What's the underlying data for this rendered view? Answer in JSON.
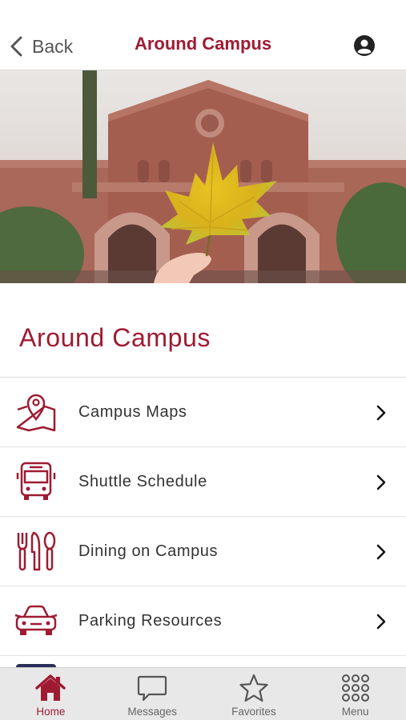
{
  "header": {
    "back_label": "Back",
    "title": "Around Campus"
  },
  "section": {
    "title": "Around Campus"
  },
  "list": [
    {
      "label": "Campus Maps",
      "icon": "map-pin-icon"
    },
    {
      "label": "Shuttle Schedule",
      "icon": "bus-icon"
    },
    {
      "label": "Dining on Campus",
      "icon": "utensils-icon"
    },
    {
      "label": "Parking Resources",
      "icon": "car-icon"
    }
  ],
  "tabbar": {
    "tabs": [
      {
        "label": "Home",
        "icon": "home-icon",
        "active": true
      },
      {
        "label": "Messages",
        "icon": "chat-bubble-icon",
        "active": false
      },
      {
        "label": "Favorites",
        "icon": "star-icon",
        "active": false
      },
      {
        "label": "Menu",
        "icon": "grid-icon",
        "active": false
      }
    ]
  },
  "colors": {
    "accent": "#9e1b32",
    "text": "#333333",
    "tabbar_bg": "#e8e8e8",
    "inactive_tab": "#666666"
  }
}
